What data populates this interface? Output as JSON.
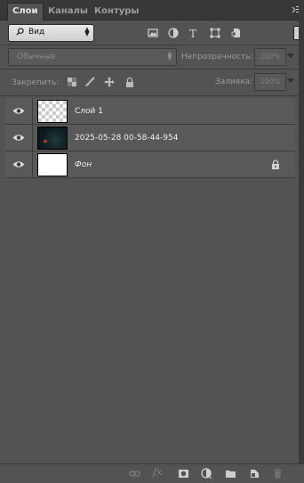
{
  "tabs": [
    {
      "label": "Слои",
      "active": true
    },
    {
      "label": "Каналы",
      "active": false
    },
    {
      "label": "Контуры",
      "active": false
    }
  ],
  "filter": {
    "kind_label": "Вид",
    "icons": [
      "image-filter-icon",
      "adjustment-filter-icon",
      "type-filter-icon",
      "shape-filter-icon",
      "smart-object-filter-icon"
    ]
  },
  "blend": {
    "mode": "Обычные",
    "opacity_label": "Непрозрачность:",
    "opacity_value": "100%"
  },
  "lock": {
    "label": "Закрепить:",
    "fill_label": "Заливка:",
    "fill_value": "100%"
  },
  "layers": [
    {
      "name": "Слой 1",
      "thumb": "transparent",
      "visible": true,
      "locked": false,
      "italic": false
    },
    {
      "name": "2025-05-28 00-58-44-954",
      "thumb": "photo",
      "visible": true,
      "locked": false,
      "italic": false
    },
    {
      "name": "Фон",
      "thumb": "white",
      "visible": true,
      "locked": true,
      "italic": true
    }
  ],
  "bottom_bar": {
    "fx_label": "fx",
    "icons": [
      "link-layers-icon",
      "fx-icon",
      "add-mask-icon",
      "adjustment-layer-icon",
      "new-group-icon",
      "new-layer-icon",
      "delete-layer-icon"
    ]
  },
  "colors": {
    "panel_bg": "#535353",
    "tabbar_bg": "#383838",
    "layer_row_bg": "#595959",
    "text": "#eeeeee"
  }
}
